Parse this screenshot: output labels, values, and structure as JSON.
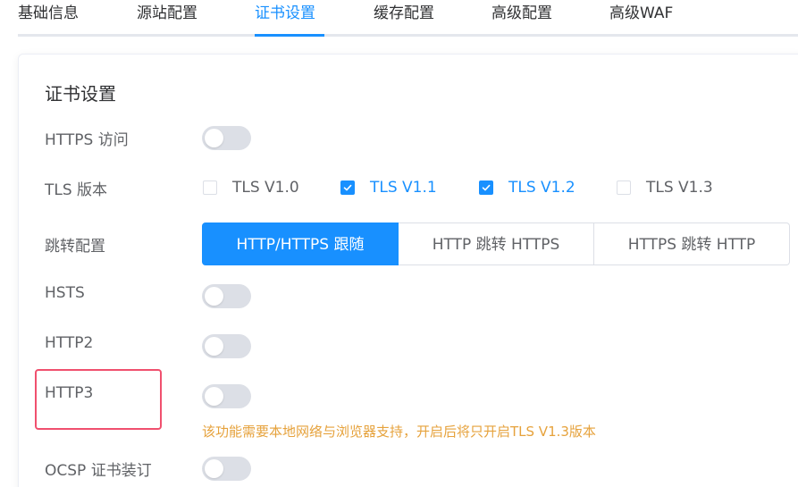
{
  "tabs": [
    {
      "label": "基础信息",
      "active": false
    },
    {
      "label": "源站配置",
      "active": false
    },
    {
      "label": "证书设置",
      "active": true
    },
    {
      "label": "缓存配置",
      "active": false
    },
    {
      "label": "高级配置",
      "active": false
    },
    {
      "label": "高级WAF",
      "active": false
    }
  ],
  "section": {
    "title": "证书设置"
  },
  "settings": {
    "https_access": {
      "label": "HTTPS 访问",
      "enabled": false
    },
    "tls_version": {
      "label": "TLS 版本",
      "options": [
        {
          "label": "TLS V1.0",
          "checked": false
        },
        {
          "label": "TLS V1.1",
          "checked": true
        },
        {
          "label": "TLS V1.2",
          "checked": true
        },
        {
          "label": "TLS V1.3",
          "checked": false
        }
      ]
    },
    "redirect": {
      "label": "跳转配置",
      "options": [
        {
          "label": "HTTP/HTTPS 跟随",
          "selected": true
        },
        {
          "label": "HTTP 跳转 HTTPS",
          "selected": false
        },
        {
          "label": "HTTPS 跳转 HTTP",
          "selected": false
        }
      ]
    },
    "hsts": {
      "label": "HSTS",
      "enabled": false
    },
    "http2": {
      "label": "HTTP2",
      "enabled": false
    },
    "http3": {
      "label": "HTTP3",
      "enabled": false,
      "hint": "该功能需要本地网络与浏览器支持，开启后将只开启TLS V1.3版本"
    },
    "ocsp": {
      "label": "OCSP 证书装订",
      "enabled": false
    }
  },
  "colors": {
    "accent": "#1890ff",
    "switch_off": "#dcdfe6",
    "hint": "#e6a23c",
    "highlight": "#f0506e"
  }
}
